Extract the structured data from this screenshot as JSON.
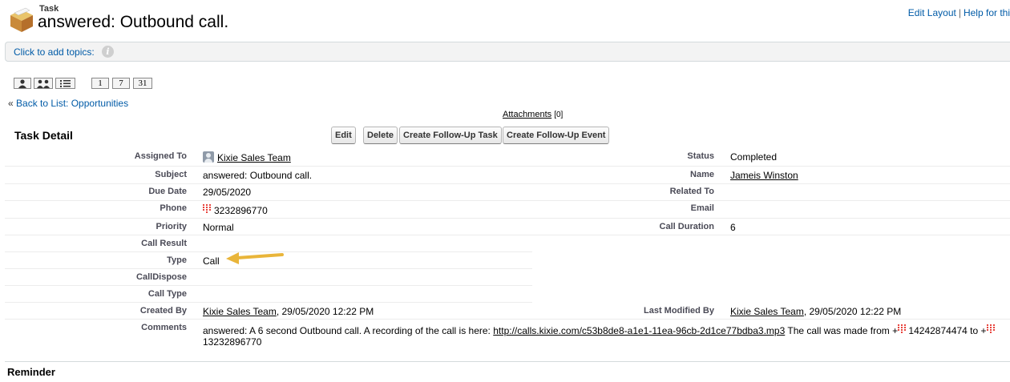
{
  "header": {
    "object_label": "Task",
    "title": "answered: Outbound call.",
    "edit_layout": "Edit Layout",
    "separator": "|",
    "help": "Help for thi"
  },
  "topics": {
    "link": "Click to add topics:",
    "info_glyph": "i"
  },
  "toolbar": {
    "day": "1",
    "week": "7",
    "month": "31"
  },
  "back": {
    "prefix": "«",
    "label": "Back to List: Opportunities"
  },
  "attachments": {
    "label": "Attachments",
    "count": "[0]"
  },
  "detail": {
    "title": "Task Detail",
    "buttons": {
      "edit": "Edit",
      "delete": "Delete",
      "follow_task": "Create Follow-Up Task",
      "follow_event": "Create Follow-Up Event"
    },
    "left": {
      "assigned_to": {
        "label": "Assigned To",
        "value": "Kixie Sales Team"
      },
      "subject": {
        "label": "Subject",
        "value": "answered: Outbound call."
      },
      "due_date": {
        "label": "Due Date",
        "value": "29/05/2020"
      },
      "phone": {
        "label": "Phone",
        "value": "3232896770"
      },
      "priority": {
        "label": "Priority",
        "value": "Normal"
      },
      "call_result": {
        "label": "Call Result",
        "value": ""
      },
      "type": {
        "label": "Type",
        "value": "Call"
      },
      "call_dispose": {
        "label": "CallDispose",
        "value": ""
      },
      "call_type": {
        "label": "Call Type",
        "value": ""
      },
      "created_by": {
        "label": "Created By",
        "user": "Kixie Sales Team",
        "date": ", 29/05/2020 12:22 PM"
      },
      "comments": {
        "label": "Comments",
        "text1": "answered: A 6 second Outbound call. A recording of the call is here: ",
        "link": "http://calls.kixie.com/c53b8de8-a1e1-11ea-96cb-2d1ce77bdba3.mp3",
        "text2": " The call was made from +",
        "from": " 14242874474",
        "text3": " to +",
        "to": "13232896770"
      }
    },
    "right": {
      "status": {
        "label": "Status",
        "value": "Completed"
      },
      "name": {
        "label": "Name",
        "value": "Jameis Winston"
      },
      "related_to": {
        "label": "Related To",
        "value": ""
      },
      "email": {
        "label": "Email",
        "value": ""
      },
      "call_duration": {
        "label": "Call Duration",
        "value": "6"
      },
      "last_modified_by": {
        "label": "Last Modified By",
        "user": "Kixie Sales Team",
        "date": ", 29/05/2020 12:22 PM"
      }
    }
  },
  "reminder": {
    "title": "Reminder"
  },
  "colors": {
    "link": "#015ba7",
    "arrow": "#e9b53a",
    "kixie_red": "#e8423b"
  },
  "icons": {
    "task": "task-box-icon",
    "user": "user-icon",
    "phone": "kixie-phone-icon",
    "info": "info-icon",
    "arrow": "annotation-arrow"
  }
}
